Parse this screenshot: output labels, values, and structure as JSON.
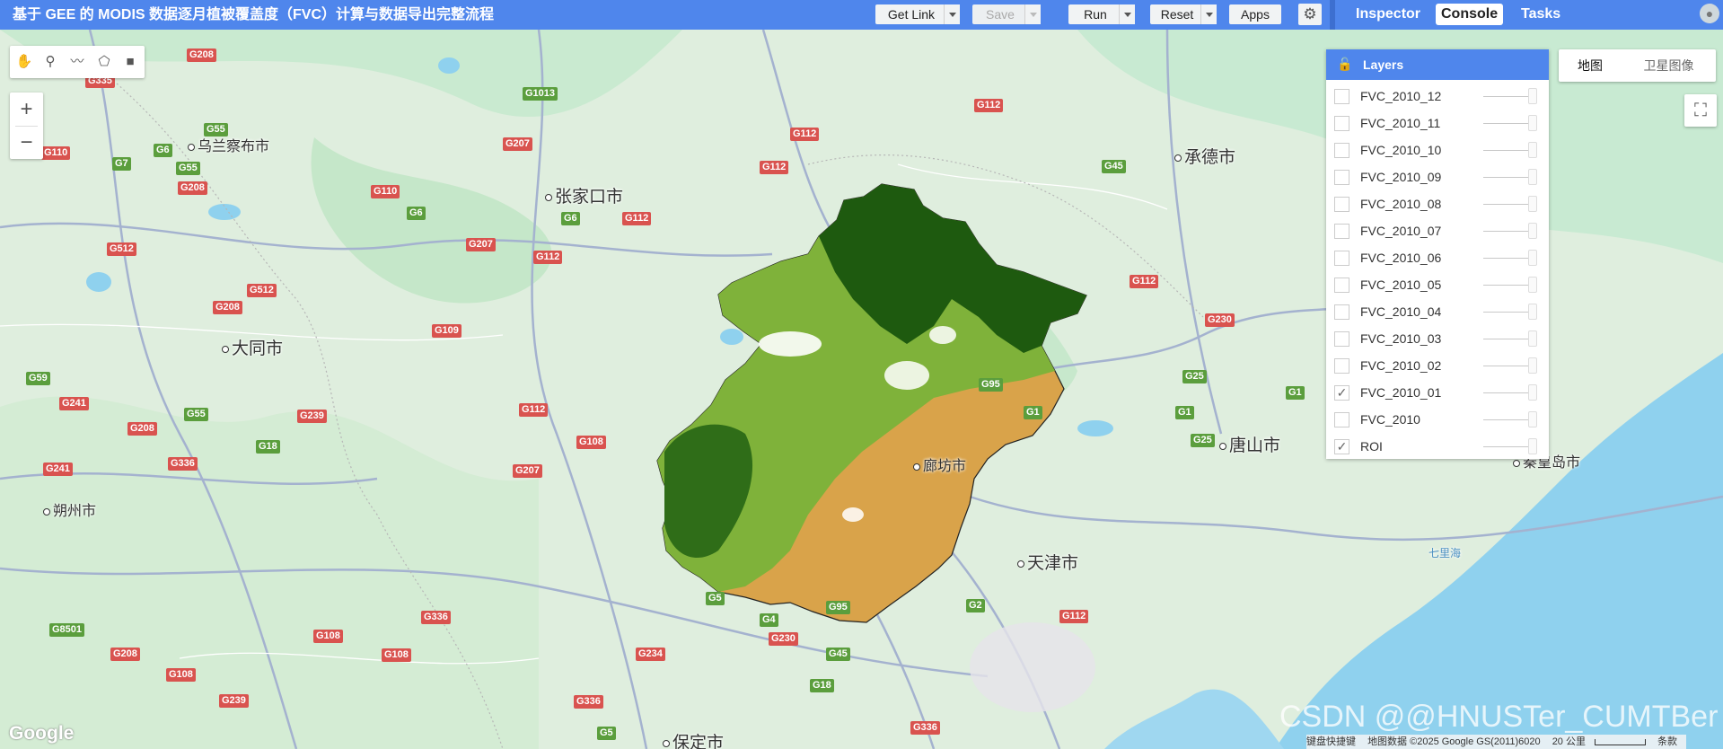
{
  "topbar": {
    "title": "基于 GEE 的 MODIS 数据逐月植被覆盖度（FVC）计算与数据导出完整流程",
    "get_link_label": "Get Link",
    "save_label": "Save",
    "run_label": "Run",
    "reset_label": "Reset",
    "apps_label": "Apps",
    "settings_icon": "gear-icon",
    "tabs": [
      {
        "label": "Inspector",
        "active": false
      },
      {
        "label": "Console",
        "active": true
      },
      {
        "label": "Tasks",
        "active": false
      }
    ]
  },
  "map": {
    "zoom_in": "+",
    "zoom_out": "−",
    "places": [
      {
        "name": "乌兰察布市"
      },
      {
        "name": "张家口市"
      },
      {
        "name": "承德市"
      },
      {
        "name": "大同市"
      },
      {
        "name": "廊坊市"
      },
      {
        "name": "唐山市"
      },
      {
        "name": "朔州市"
      },
      {
        "name": "天津市"
      },
      {
        "name": "保定市"
      },
      {
        "name": "秦皇岛市"
      },
      {
        "name": "七里海"
      }
    ],
    "map_type": {
      "options": [
        "地图",
        "卫星图像"
      ],
      "selected": "地图"
    },
    "google_logo": "Google",
    "attribution": {
      "shortcuts": "键盘快捷键",
      "data": "地图数据 ©2025 Google GS(2011)6020",
      "scale": "20 公里",
      "terms": "条款"
    },
    "watermark": "CSDN @@HNUSTer_CUMTBer"
  },
  "layers": {
    "title": "Layers",
    "items": [
      {
        "name": "FVC_2010_12",
        "checked": false
      },
      {
        "name": "FVC_2010_11",
        "checked": false
      },
      {
        "name": "FVC_2010_10",
        "checked": false
      },
      {
        "name": "FVC_2010_09",
        "checked": false
      },
      {
        "name": "FVC_2010_08",
        "checked": false
      },
      {
        "name": "FVC_2010_07",
        "checked": false
      },
      {
        "name": "FVC_2010_06",
        "checked": false
      },
      {
        "name": "FVC_2010_05",
        "checked": false
      },
      {
        "name": "FVC_2010_04",
        "checked": false
      },
      {
        "name": "FVC_2010_03",
        "checked": false
      },
      {
        "name": "FVC_2010_02",
        "checked": false
      },
      {
        "name": "FVC_2010_01",
        "checked": true
      },
      {
        "name": "FVC_2010",
        "checked": false
      },
      {
        "name": "ROI",
        "checked": true
      }
    ],
    "check_mark": "✓"
  },
  "colors": {
    "accent": "#4f86ec",
    "fvc_high": "#1e5a0f",
    "fvc_mid": "#7fb23a",
    "fvc_low": "#d9a34a"
  }
}
